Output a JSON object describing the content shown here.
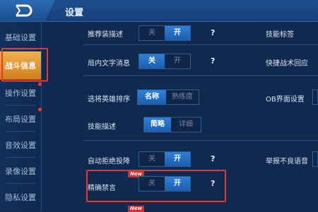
{
  "header": {
    "title": "设置"
  },
  "sidebar": {
    "items": [
      {
        "label": "基础设置"
      },
      {
        "label": "战斗信息"
      },
      {
        "label": "操作设置"
      },
      {
        "label": "布局设置"
      },
      {
        "label": "音效设置"
      },
      {
        "label": "录像设置"
      },
      {
        "label": "隐私设置"
      }
    ],
    "active_index": 1
  },
  "settings": {
    "recommend_desc": {
      "label": "推荐装描述",
      "off": "关",
      "on": "开"
    },
    "skill_mark": {
      "label": "技能标签"
    },
    "local_text": {
      "label": "局内文字消息",
      "off": "关",
      "on": "开"
    },
    "quick_reply": {
      "label": "快捷战术回应"
    },
    "hero_sort": {
      "label": "选将英雄排序",
      "opt1": "名称",
      "opt2": "熟练度"
    },
    "ob_ui": {
      "label": "OB界面设置"
    },
    "skill_desc": {
      "label": "技能描述",
      "opt1": "简略",
      "opt2": "详细"
    },
    "auto_reject": {
      "label": "自动拒绝投降",
      "off": "关",
      "on": "开"
    },
    "report_voice": {
      "label": "举报不良语音"
    },
    "precise_mute": {
      "label": "精确禁言",
      "off": "关",
      "on": "开",
      "badge": "New"
    },
    "next_badge": "New",
    "help_mark": "?"
  },
  "colors": {
    "accent": "#2f80d8",
    "active_tab": "#e9a23f",
    "highlight": "#e23a2c"
  }
}
